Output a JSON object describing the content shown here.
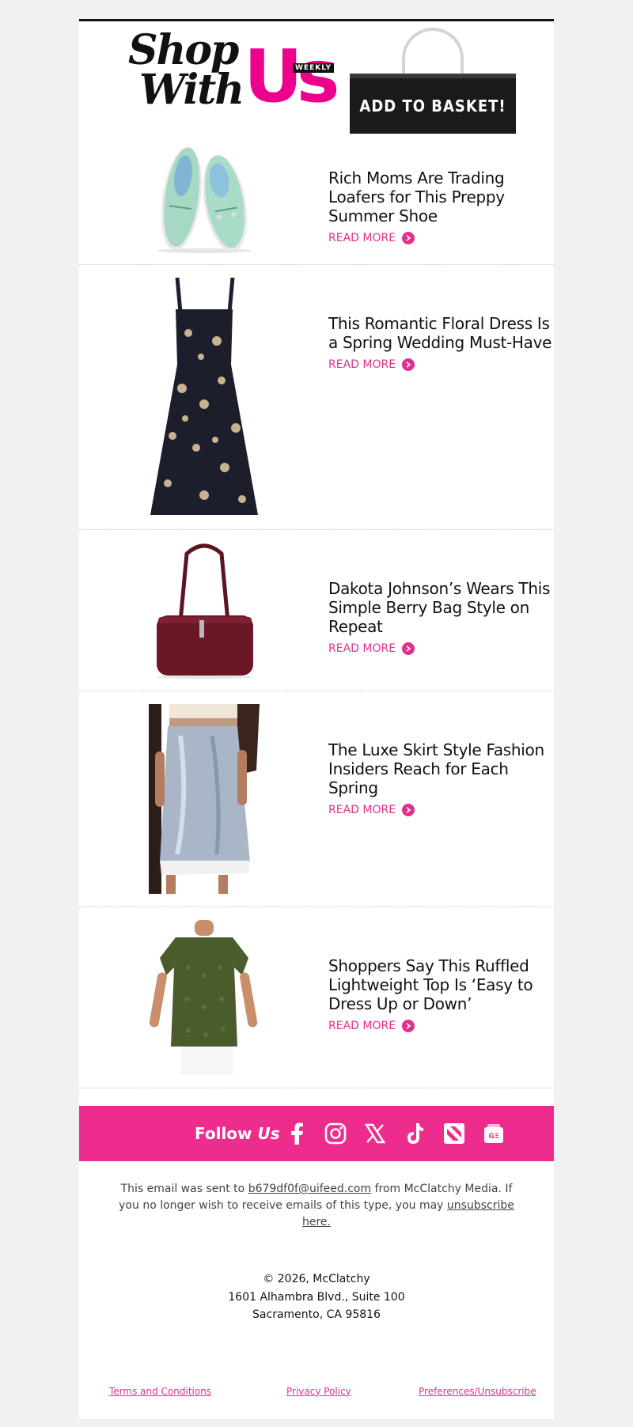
{
  "header": {
    "logo_shop": "Shop",
    "logo_with": "With",
    "logo_us": "Us",
    "logo_weekly": "WEEKLY",
    "basket_label": "ADD TO BASKET!"
  },
  "articles": [
    {
      "title": "Rich Moms Are Trading Loafers for This Preppy Summer Shoe",
      "read_more": "READ MORE"
    },
    {
      "title": "This Romantic Floral Dress Is a Spring Wedding Must-Have",
      "read_more": "READ MORE"
    },
    {
      "title": "Dakota Johnson’s Wears This Simple Berry Bag Style on Repeat",
      "read_more": "READ MORE"
    },
    {
      "title": "The Luxe Skirt Style Fashion Insiders Reach for Each Spring",
      "read_more": "READ MORE"
    },
    {
      "title": "Shoppers Say This Ruffled Lightweight Top Is ‘Easy to Dress Up or Down’",
      "read_more": "READ MORE"
    }
  ],
  "follow": {
    "label": "Follow",
    "label_us": "Us",
    "icons": [
      "facebook-icon",
      "instagram-icon",
      "x-icon",
      "tiktok-icon",
      "apple-news-icon",
      "google-news-icon"
    ]
  },
  "footer": {
    "sent_prefix": "This email was sent to",
    "email": "b679df0f@uifeed.com",
    "sent_suffix": "from McClatchy Media. If you no longer wish to receive emails of this type, you may",
    "unsubscribe": "unsubscribe here.",
    "copyright": "© 2026, McClatchy",
    "address_line1": "1601 Alhambra Blvd., Suite 100",
    "address_line2": "Sacramento, CA 95816",
    "links": [
      "Terms and Conditions",
      "Privacy Policy",
      "Preferences/Unsubscribe"
    ]
  },
  "colors": {
    "brand_pink": "#ec008c",
    "follow_bar": "#ee2c8d",
    "link_pink": "#e0318e"
  }
}
